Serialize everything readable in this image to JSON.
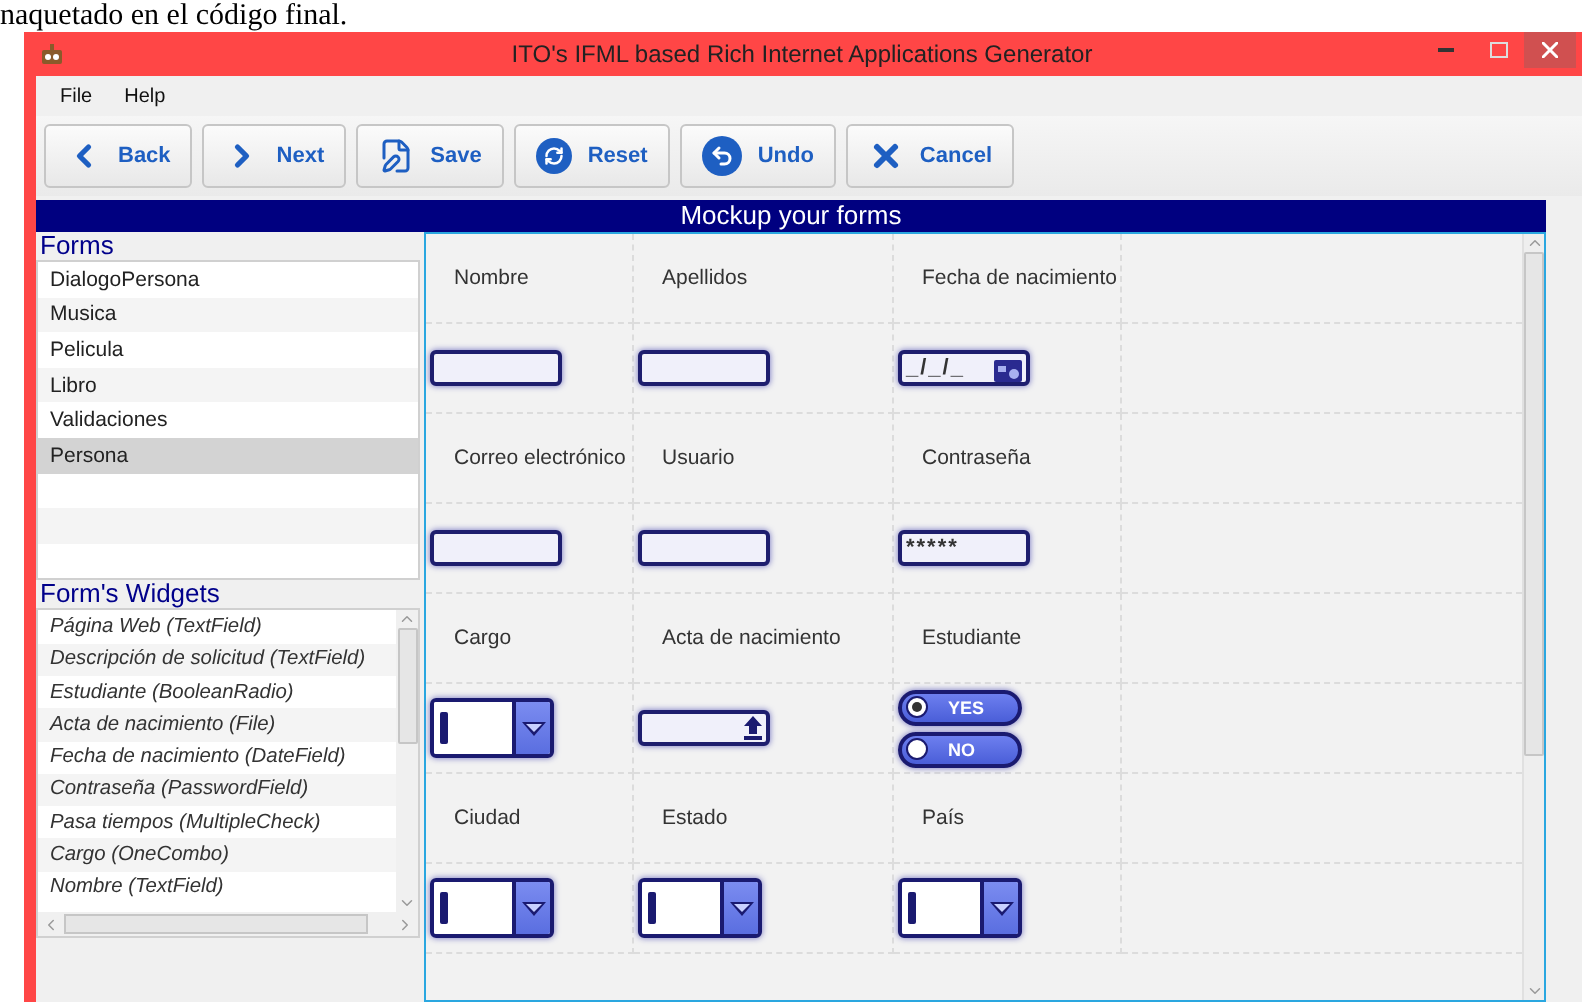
{
  "document_text": "naquetado en el código final.",
  "window": {
    "title": "ITO's IFML based Rich Internet Applications Generator"
  },
  "menu": [
    "File",
    "Help"
  ],
  "toolbar": [
    {
      "label": "Back",
      "kind": "back"
    },
    {
      "label": "Next",
      "kind": "next"
    },
    {
      "label": "Save",
      "kind": "save"
    },
    {
      "label": "Reset",
      "kind": "reset"
    },
    {
      "label": "Undo",
      "kind": "undo"
    },
    {
      "label": "Cancel",
      "kind": "cancel"
    }
  ],
  "header": "Mockup your forms",
  "forms": {
    "title": "Forms",
    "items": [
      {
        "label": "DialogoPersona",
        "selected": false
      },
      {
        "label": "Musica",
        "selected": false
      },
      {
        "label": "Pelicula",
        "selected": false
      },
      {
        "label": "Libro",
        "selected": false
      },
      {
        "label": "Validaciones",
        "selected": false
      },
      {
        "label": "Persona",
        "selected": true
      }
    ]
  },
  "widgets_list": {
    "title": "Form's Widgets",
    "items": [
      "Página Web (TextField)",
      "Descripción de solicitud (TextField)",
      "Estudiante (BooleanRadio)",
      "Acta de nacimiento (File)",
      "Fecha de nacimiento (DateField)",
      "Contraseña (PasswordField)",
      "Pasa tiempos (MultipleCheck)",
      "Cargo (OneCombo)",
      "Nombre (TextField)"
    ]
  },
  "canvas": {
    "cells": [
      {
        "label": "Nombre",
        "kind": "text"
      },
      {
        "label": "Apellidos",
        "kind": "text"
      },
      {
        "label": "Fecha de nacimiento",
        "kind": "date",
        "value": "_/_/_"
      },
      {
        "label": "Correo electrónico",
        "kind": "text"
      },
      {
        "label": "Usuario",
        "kind": "text"
      },
      {
        "label": "Contraseña",
        "kind": "password",
        "value": "*****"
      },
      {
        "label": "Cargo",
        "kind": "combo"
      },
      {
        "label": "Acta de nacimiento",
        "kind": "file"
      },
      {
        "label": "Estudiante",
        "kind": "boolean",
        "options": [
          {
            "label": "YES",
            "selected": true
          },
          {
            "label": "NO",
            "selected": false
          }
        ]
      },
      {
        "label": "Ciudad",
        "kind": "combo"
      },
      {
        "label": "Estado",
        "kind": "combo"
      },
      {
        "label": "País",
        "kind": "combo"
      }
    ]
  }
}
